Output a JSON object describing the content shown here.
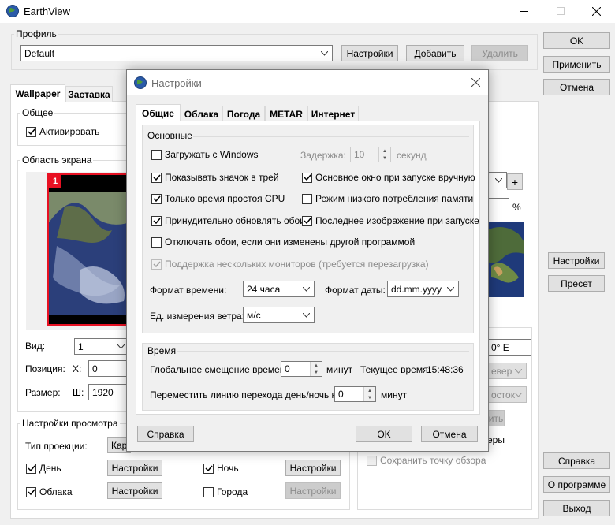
{
  "window": {
    "title": "EarthView",
    "icon": "earth-icon"
  },
  "profile": {
    "group_title": "Профиль",
    "value": "Default",
    "settings_label": "Настройки",
    "add_label": "Добавить",
    "delete_label": "Удалить"
  },
  "right_buttons": {
    "ok": "OK",
    "apply": "Применить",
    "cancel": "Отмена",
    "settings": "Настройки",
    "preset": "Пресет",
    "help": "Справка",
    "about": "О программе",
    "exit": "Выход"
  },
  "main_tabs": [
    "Wallpaper",
    "Заставка"
  ],
  "general": {
    "title": "Общее",
    "activate": "Активировать"
  },
  "screen_area": {
    "title": "Область экрана",
    "monitor_number": "1",
    "view_label": "Вид:",
    "view_value": "1",
    "position_label": "Позиция:",
    "x_label": "X:",
    "x_value": "0",
    "size_label": "Размер:",
    "w_label": "Ш:",
    "w_value": "1920",
    "percent": "%",
    "plus": "+"
  },
  "view_settings": {
    "title": "Настройки просмотра",
    "projection_label": "Тип проекции:",
    "projection_value": "Карт",
    "day": "День",
    "clouds": "Облака",
    "night": "Ночь",
    "cities": "Города",
    "settings_label": "Настройки"
  },
  "right_panel": {
    "longitude": "0° E",
    "north_value": "евер",
    "east_value": "осток",
    "apply_partial": "ить",
    "cameras_partial": "еры",
    "save_viewpoint": "Сохранить точку обзора"
  },
  "dialog": {
    "title": "Настройки",
    "tabs": [
      "Общие",
      "Облака",
      "Погода",
      "METAR",
      "Интернет"
    ],
    "basic_title": "Основные",
    "load_with_windows": "Загружать с Windows",
    "delay_label": "Задержка:",
    "delay_value": "10",
    "seconds": "секунд",
    "show_tray_icon": "Показывать значок в трей",
    "main_window_manual": "Основное окно при запуске вручную",
    "idle_cpu": "Только время простоя CPU",
    "low_memory": "Режим низкого потребления памяти",
    "force_update": "Принудительно обновлять обои",
    "last_image_start": "Последнее изображение при запуске",
    "disable_if_changed": "Отключать обои, если они изменены другой программой",
    "multi_monitor": "Поддержка нескольких мониторов (требуется перезагрузка)",
    "time_format_label": "Формат времени:",
    "time_format_value": "24 часа",
    "date_format_label": "Формат даты:",
    "date_format_value": "dd.mm.yyyy",
    "wind_unit_label": "Ед. измерения ветра:",
    "wind_unit_value": "м/с",
    "time_title": "Время",
    "global_offset_label": "Глобальное смещение времени:",
    "global_offset_value": "0",
    "minutes": "минут",
    "current_time_label": "Текущее время:",
    "current_time_value": "15:48:36",
    "daynight_label": "Переместить линию перехода день/ночь на:",
    "daynight_value": "0",
    "minutes2": "минут",
    "help_label": "Справка",
    "ok_label": "OK",
    "cancel_label": "Отмена"
  },
  "colors": {
    "accent": "#0078d7",
    "monitor_border": "#e81123"
  }
}
